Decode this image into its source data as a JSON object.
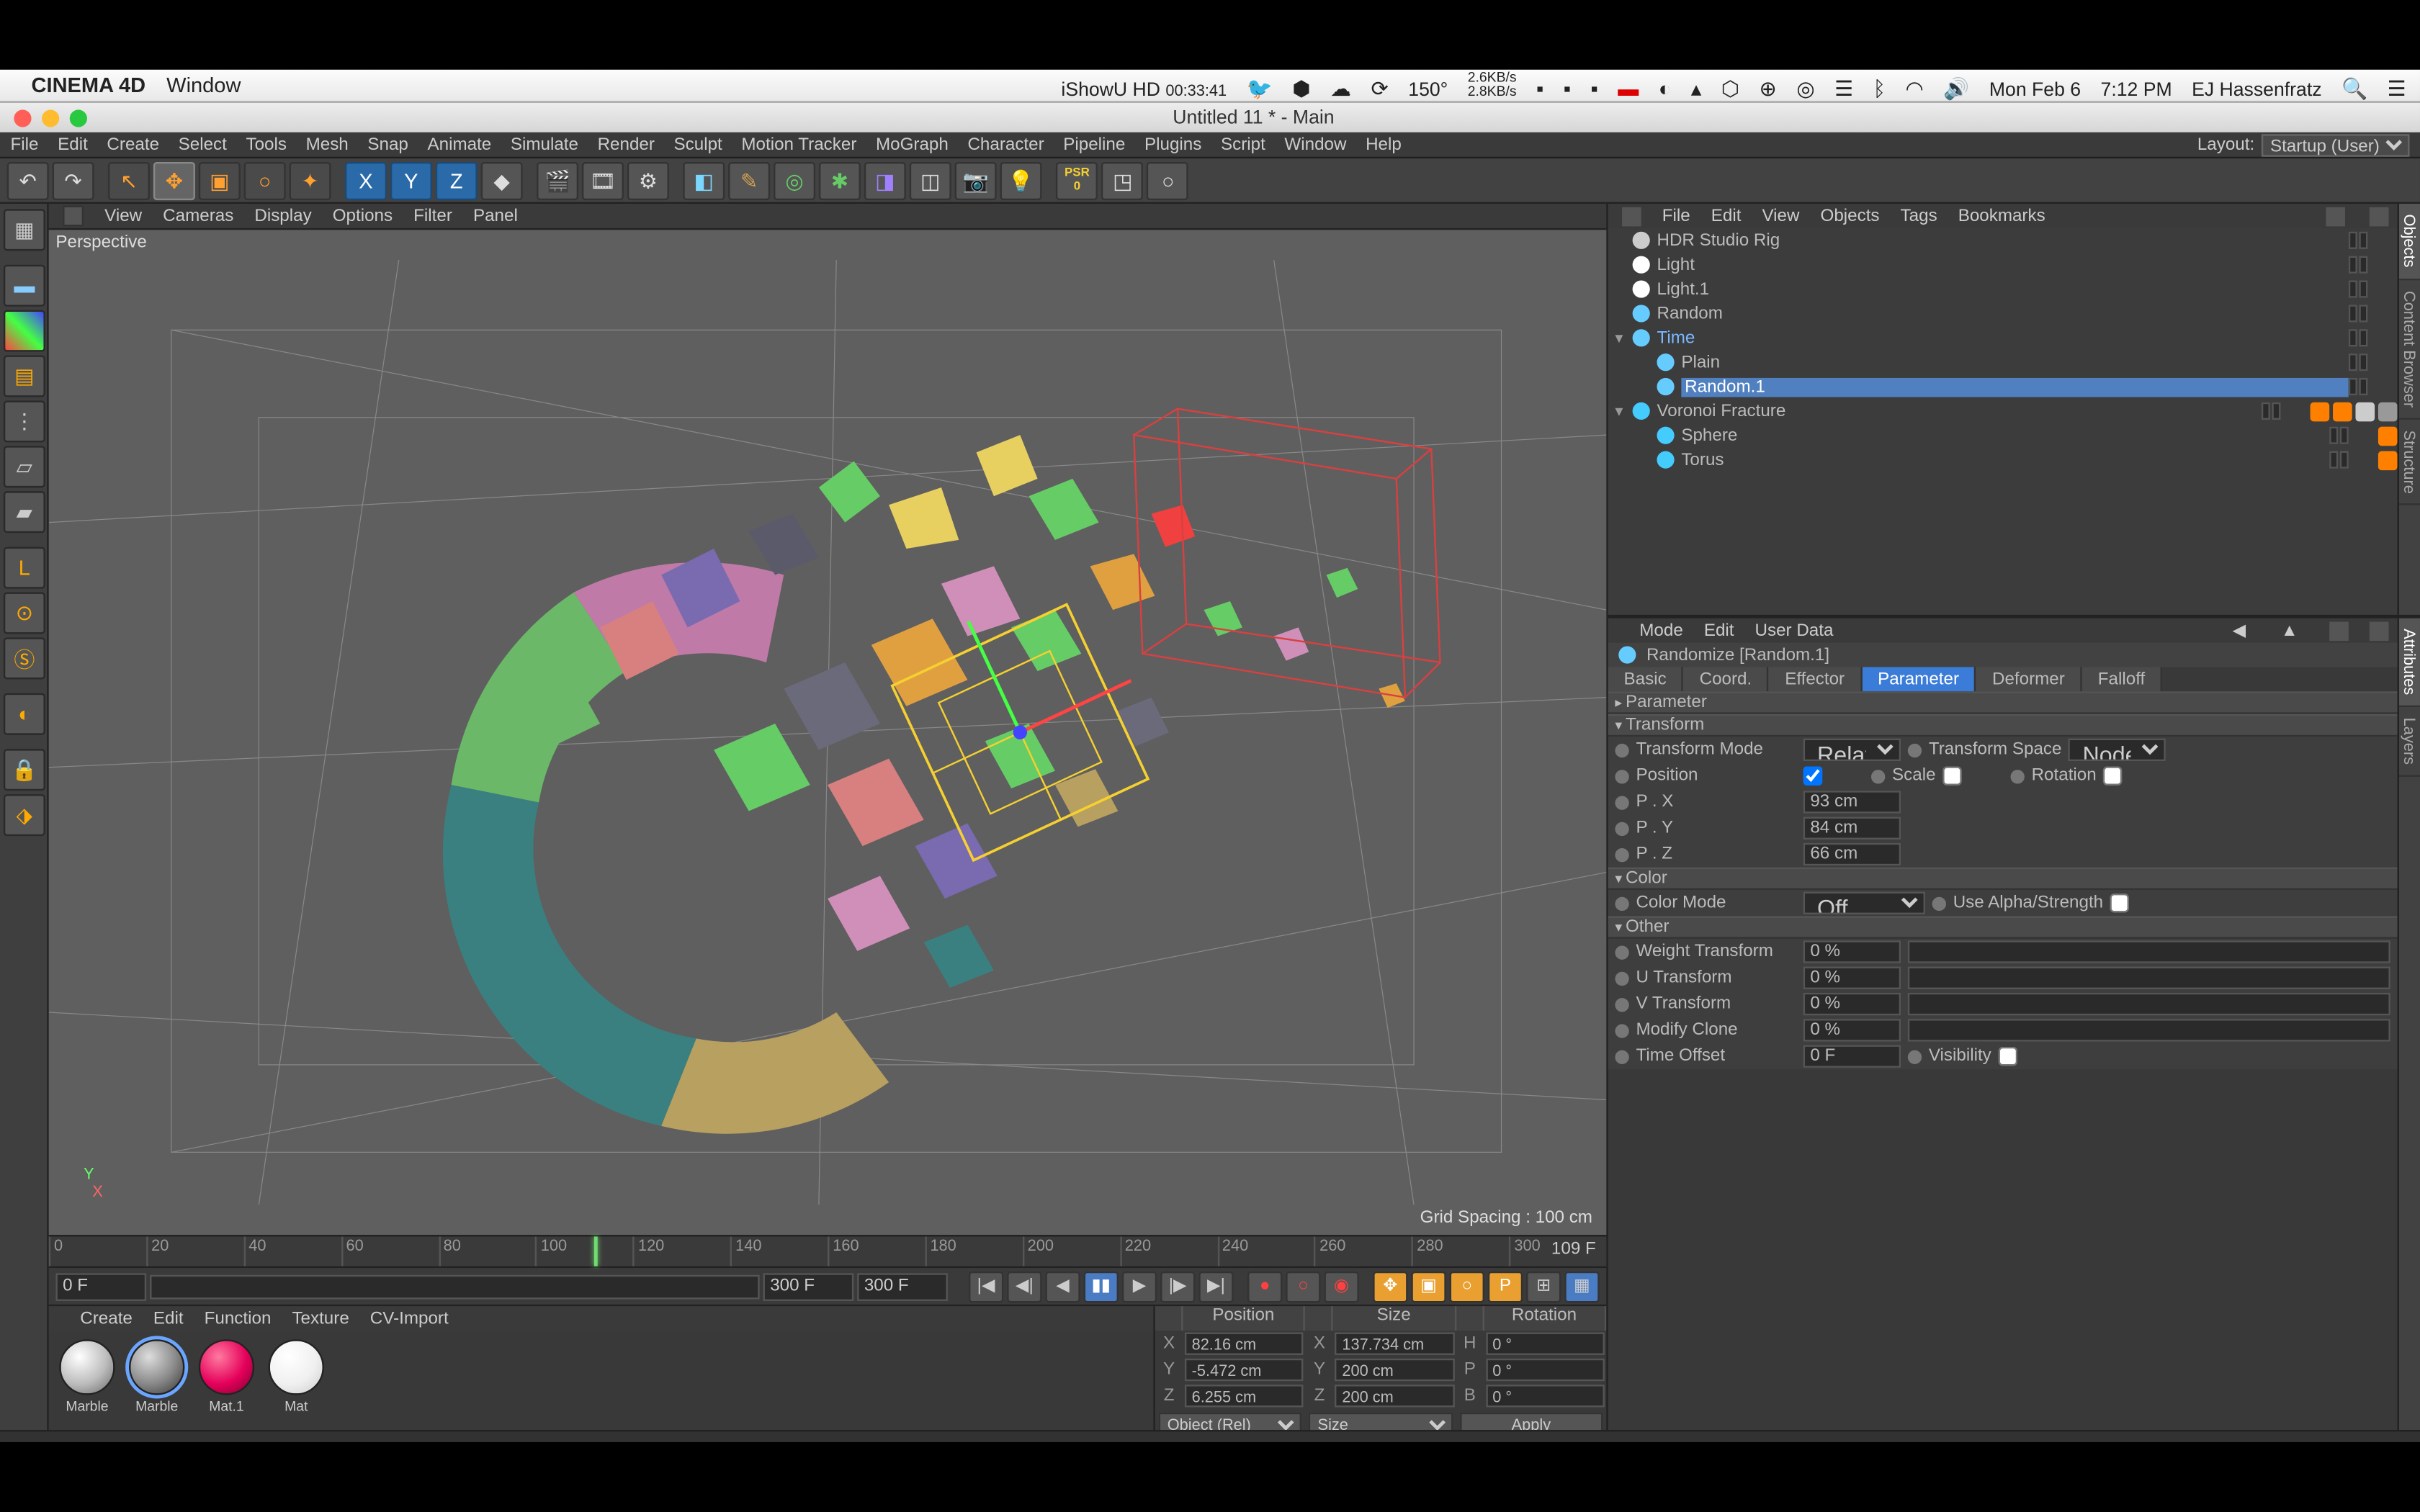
{
  "os": {
    "app": "CINEMA 4D",
    "menu": [
      "Window"
    ],
    "date": "Mon Feb 6",
    "time": "7:12 PM",
    "user": "EJ Hassenfratz",
    "temp": "150°",
    "net": "2.6KB/s",
    "net2": "2.8KB/s",
    "recorder": "iShowU HD",
    "rectime": "00:33:41"
  },
  "win": {
    "title": "Untitled 11 * - Main"
  },
  "menu": [
    "File",
    "Edit",
    "Create",
    "Select",
    "Tools",
    "Mesh",
    "Snap",
    "Animate",
    "Simulate",
    "Render",
    "Sculpt",
    "Motion Tracker",
    "MoGraph",
    "Character",
    "Pipeline",
    "Plugins",
    "Script",
    "Window",
    "Help"
  ],
  "layout": {
    "label": "Layout:",
    "value": "Startup (User)"
  },
  "viewport": {
    "menu": [
      "View",
      "Cameras",
      "Display",
      "Options",
      "Filter",
      "Panel"
    ],
    "label": "Perspective",
    "gridinfo": "Grid Spacing : 100 cm"
  },
  "timeline": {
    "ticks": [
      "0",
      "20",
      "40",
      "60",
      "80",
      "100",
      "120",
      "140",
      "160",
      "180",
      "200",
      "220",
      "240",
      "260",
      "280",
      "300"
    ],
    "curframe": "109 F",
    "start": "0 F",
    "end": "300 F",
    "endfield": "300 F"
  },
  "materials": {
    "menu": [
      "Create",
      "Edit",
      "Function",
      "Texture",
      "CV-Import"
    ],
    "items": [
      {
        "name": "Marble",
        "color": "radial-gradient(circle at 35% 30%, #fff, #bcbcbc 55%, #666)"
      },
      {
        "name": "Marble",
        "color": "radial-gradient(circle at 35% 30%, #ddd, #888 55%, #333)",
        "selected": true
      },
      {
        "name": "Mat.1",
        "color": "radial-gradient(circle at 35% 30%, #ff7aa0, #e5005a 55%, #7a002f)"
      },
      {
        "name": "Mat",
        "color": "radial-gradient(circle at 35% 30%, #fff, #f0f0f0 55%, #ccc)"
      }
    ]
  },
  "coords": {
    "headers": [
      "Position",
      "Size",
      "Rotation"
    ],
    "rows": [
      {
        "axis": "X",
        "pos": "82.16 cm",
        "size": "137.734 cm",
        "rotlbl": "H",
        "rot": "0 °"
      },
      {
        "axis": "Y",
        "pos": "-5.472 cm",
        "size": "200 cm",
        "rotlbl": "P",
        "rot": "0 °"
      },
      {
        "axis": "Z",
        "pos": "6.255 cm",
        "size": "200 cm",
        "rotlbl": "B",
        "rot": "0 °"
      }
    ],
    "mode1": "Object (Rel)",
    "mode2": "Size",
    "apply": "Apply"
  },
  "om": {
    "menu": [
      "File",
      "Edit",
      "View",
      "Objects",
      "Tags",
      "Bookmarks"
    ],
    "items": [
      {
        "name": "HDR Studio Rig",
        "indent": 0,
        "icon": "#ccc",
        "exp": ""
      },
      {
        "name": "Light",
        "indent": 0,
        "icon": "#fff",
        "exp": ""
      },
      {
        "name": "Light.1",
        "indent": 0,
        "icon": "#fff",
        "exp": ""
      },
      {
        "name": "Random",
        "indent": 0,
        "icon": "#6cf",
        "exp": ""
      },
      {
        "name": "Time",
        "indent": 0,
        "icon": "#6cf",
        "exp": "▾",
        "blue": true
      },
      {
        "name": "Plain",
        "indent": 1,
        "icon": "#6cf",
        "exp": ""
      },
      {
        "name": "Random.1",
        "indent": 1,
        "icon": "#6cf",
        "exp": "",
        "selected": true
      },
      {
        "name": "Voronoi Fracture",
        "indent": 0,
        "icon": "#4cf",
        "exp": "▾",
        "tags": [
          "#ff8000",
          "#ff8000",
          "#ccc",
          "#999"
        ]
      },
      {
        "name": "Sphere",
        "indent": 1,
        "icon": "#4cf",
        "exp": "",
        "tags": [
          "#ff8000"
        ]
      },
      {
        "name": "Torus",
        "indent": 1,
        "icon": "#4cf",
        "exp": "",
        "tags": [
          "#ff8000"
        ]
      }
    ]
  },
  "attr": {
    "menu": [
      "Mode",
      "Edit",
      "User Data"
    ],
    "title": "Randomize [Random.1]",
    "tabs": [
      "Basic",
      "Coord.",
      "Effector",
      "Parameter",
      "Deformer",
      "Falloff"
    ],
    "active_tab": "Parameter",
    "groups": {
      "parameter": "Parameter",
      "transform": "Transform",
      "color": "Color",
      "other": "Other"
    },
    "transform": {
      "mode_label": "Transform Mode",
      "mode": "Relative",
      "space_label": "Transform Space",
      "space": "Node",
      "position_label": "Position",
      "position": true,
      "scale_label": "Scale",
      "scale": false,
      "rotation_label": "Rotation",
      "rotation": false,
      "px_label": "P . X",
      "px": "93 cm",
      "py_label": "P . Y",
      "py": "84 cm",
      "pz_label": "P . Z",
      "pz": "66 cm"
    },
    "color": {
      "mode_label": "Color Mode",
      "mode": "Off",
      "alpha_label": "Use Alpha/Strength"
    },
    "other": {
      "weight_label": "Weight Transform",
      "weight": "0 %",
      "u_label": "U Transform",
      "u": "0 %",
      "v_label": "V Transform",
      "v": "0 %",
      "clone_label": "Modify Clone",
      "clone": "0 %",
      "time_label": "Time Offset",
      "time": "0 F",
      "vis_label": "Visibility"
    }
  },
  "sidetabs_top": [
    "Objects",
    "Content Browser",
    "Structure"
  ],
  "sidetabs_bot": [
    "Attributes",
    "Layers"
  ]
}
